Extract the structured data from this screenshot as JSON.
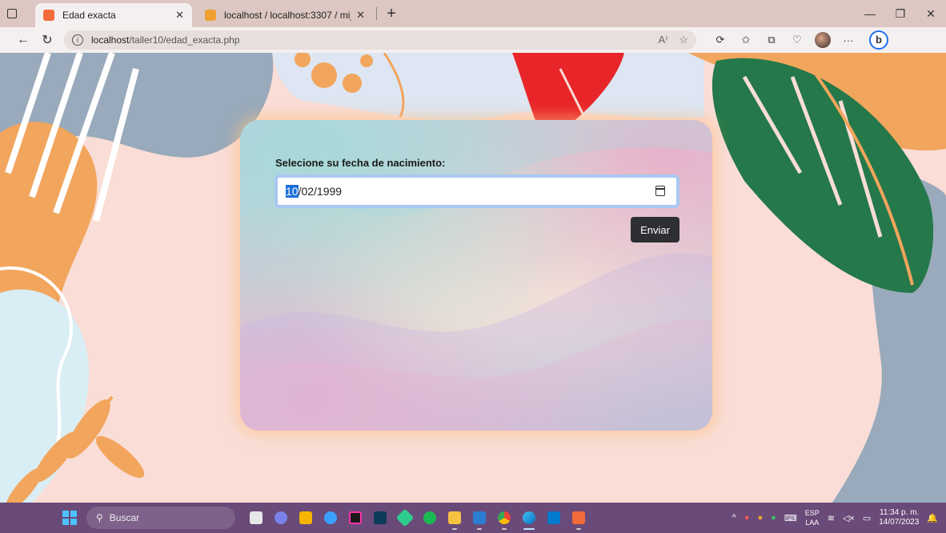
{
  "browser": {
    "tabs": [
      {
        "title": "Edad exacta",
        "active": true,
        "favicon_color": "#f26b3a"
      },
      {
        "title": "localhost / localhost:3307 / mi_p",
        "active": false,
        "favicon_color": "#f0a030"
      }
    ],
    "url_host": "localhost",
    "url_path": "/taller10/edad_exacta.php"
  },
  "form": {
    "label": "Selecione su fecha de nacimiento:",
    "date_selected_part": "10",
    "date_rest": "/02/1999",
    "submit_label": "Enviar"
  },
  "taskbar": {
    "search_placeholder": "Buscar",
    "lang_line1": "ESP",
    "lang_line2": "LAA",
    "time": "11:34 p. m.",
    "date": "14/07/2023"
  },
  "colors": {
    "accent": "#1b6fd8",
    "button": "#2d2f33",
    "taskbar": "#6a4a78"
  }
}
